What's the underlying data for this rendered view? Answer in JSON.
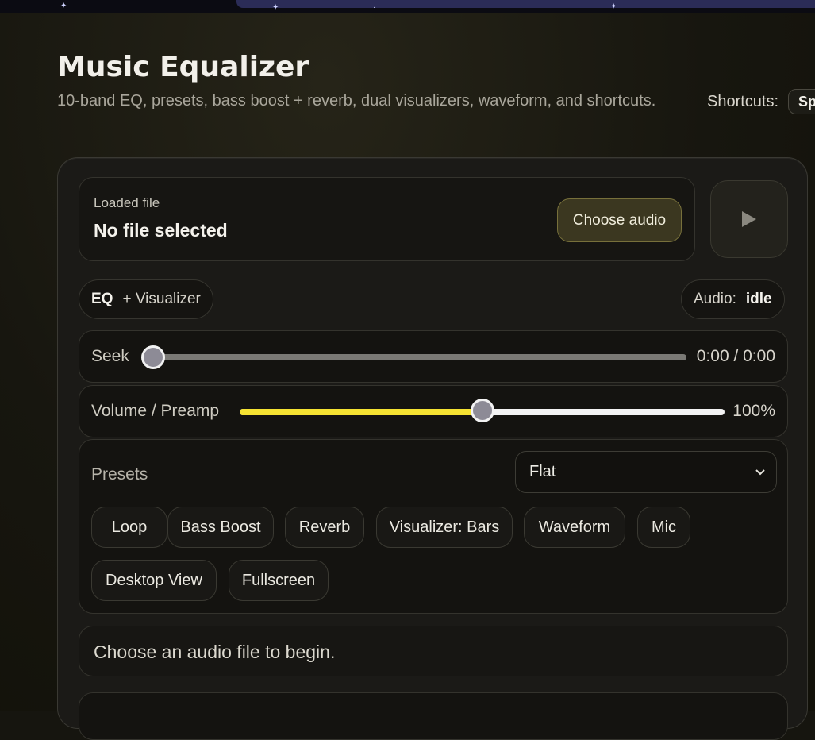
{
  "header": {
    "title": "Music Equalizer",
    "subtitle": "10-band EQ, presets, bass boost + reverb, dual visualizers, waveform, and shortcuts.",
    "shortcuts_label": "Shortcuts:",
    "shortcuts_key": "Sp"
  },
  "file": {
    "label": "Loaded file",
    "name": "No file selected",
    "choose_label": "Choose audio"
  },
  "mode": {
    "primary": "EQ",
    "secondary": "+ Visualizer"
  },
  "audio_status": {
    "label": "Audio:",
    "value": "idle"
  },
  "seek": {
    "label": "Seek",
    "time": "0:00 / 0:00",
    "progress": 0
  },
  "volume": {
    "label": "Volume / Preamp",
    "value_text": "100%",
    "level": 0.5
  },
  "presets": {
    "label": "Presets",
    "selected": "Flat",
    "toggles": [
      "Loop",
      "Bass Boost",
      "Reverb",
      "Visualizer: Bars",
      "Waveform",
      "Mic",
      "Desktop View",
      "Fullscreen"
    ]
  },
  "status": {
    "message": "Choose an audio file to begin."
  },
  "colors": {
    "accent": "#f5e232",
    "background": "#16150f"
  }
}
